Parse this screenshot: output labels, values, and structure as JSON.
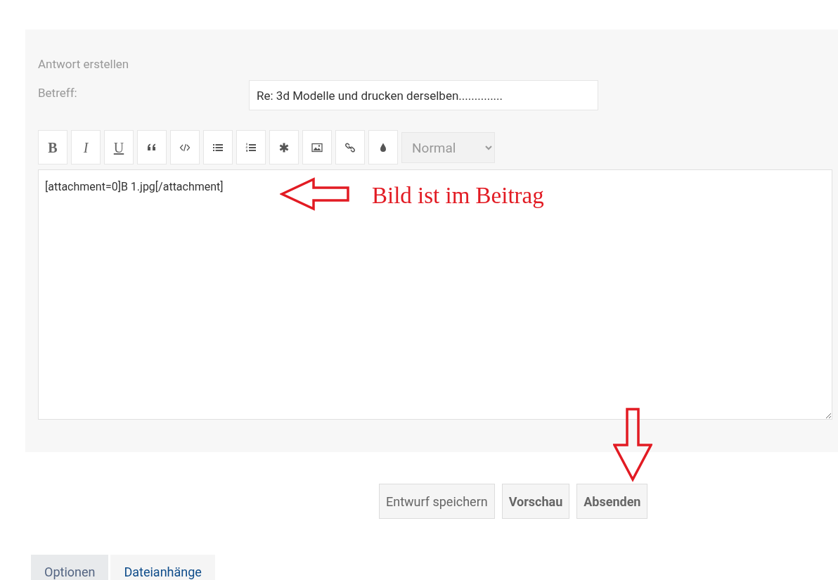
{
  "panel": {
    "title": "Antwort erstellen"
  },
  "subject": {
    "label": "Betreff:",
    "value": "Re: 3d Modelle und drucken derselben.............."
  },
  "toolbar": [
    {
      "kind": "bold",
      "label": "B"
    },
    {
      "kind": "italic",
      "label": "I"
    },
    {
      "kind": "underline",
      "label": "U"
    },
    {
      "kind": "quote"
    },
    {
      "kind": "code"
    },
    {
      "kind": "list"
    },
    {
      "kind": "ordered-list"
    },
    {
      "kind": "asterisk"
    },
    {
      "kind": "image"
    },
    {
      "kind": "link"
    },
    {
      "kind": "color"
    }
  ],
  "size_select": {
    "value": "Normal"
  },
  "message": {
    "value": "[attachment=0]B 1.jpg[/attachment]"
  },
  "annotations": [
    {
      "kind": "arrow-left"
    },
    {
      "kind": "text",
      "text": "Bild ist im Beitrag"
    },
    {
      "kind": "arrow-down"
    }
  ],
  "buttons": [
    {
      "label": "Entwurf speichern",
      "bold": false
    },
    {
      "label": "Vorschau",
      "bold": true
    },
    {
      "label": "Absenden",
      "bold": true
    }
  ],
  "tabs": [
    {
      "label": "Optionen",
      "selected": false
    },
    {
      "label": "Dateianhänge",
      "selected": true
    }
  ]
}
